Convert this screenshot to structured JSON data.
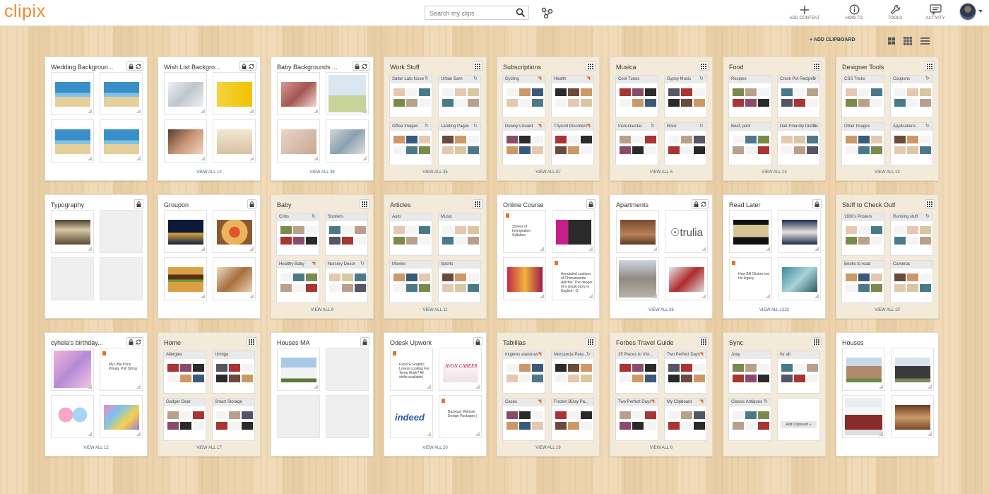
{
  "app": {
    "logo": "clipix",
    "search_placeholder": "Search my clips",
    "nav": [
      {
        "label": "ADD CONTENT",
        "icon": "plus-icon"
      },
      {
        "label": "HOW TO",
        "icon": "info-icon"
      },
      {
        "label": "TOOLS",
        "icon": "wrench-icon"
      },
      {
        "label": "ACTIVITY",
        "icon": "chat-icon"
      }
    ],
    "add_clipboard": "+ ADD CLIPBOARD"
  },
  "colors": {
    "accent": "#f28a2a",
    "link": "#3f5f86"
  },
  "cards": [
    {
      "title": "Wedding Backgroun...",
      "icons": [
        "lock",
        "sync"
      ],
      "cells": [
        "beach-chairs",
        "beach-chairs",
        "beach-chairs",
        "beach-chairs"
      ],
      "footer": ""
    },
    {
      "title": "Wish List Backgro...",
      "icons": [
        "lock",
        "sync"
      ],
      "cells": [
        "silver-gifts",
        "yellow-gift",
        "couple",
        "beach-list"
      ],
      "footer": "VIEW ALL 12"
    },
    {
      "title": "Baby Backgrounds ...",
      "icons": [
        "lock",
        "sync"
      ],
      "cells": [
        "family",
        "pregnant",
        "baby",
        "baby-bath"
      ],
      "footer": "VIEW ALL 39"
    },
    {
      "title": "Work Stuff",
      "icons": [
        "grid"
      ],
      "boards": [
        {
          "name": "Safari Lato Issue",
          "icon": "sync"
        },
        {
          "name": "Urban Barn",
          "icon": "sync"
        },
        {
          "name": "Office Images",
          "icon": "sync"
        },
        {
          "name": "Landing Pages",
          "icon": "sync"
        }
      ],
      "footer": "VIEW ALL 35"
    },
    {
      "title": "Subscriptions",
      "icons": [
        "grid"
      ],
      "boards": [
        {
          "name": "Cycling",
          "icon": "rss"
        },
        {
          "name": "Health",
          "icon": "rss"
        },
        {
          "name": "Dewey's board",
          "icon": "rss"
        },
        {
          "name": "Thyroid Disorders",
          "icon": "rss"
        }
      ],
      "footer": "VIEW ALL 57"
    },
    {
      "title": "Musica",
      "icons": [
        "grid"
      ],
      "boards": [
        {
          "name": "Cool Tunes",
          "icon": ""
        },
        {
          "name": "Gypsy Music",
          "icon": "sync"
        },
        {
          "name": "Instrumental",
          "icon": "sync"
        },
        {
          "name": "Rock",
          "icon": "sync"
        }
      ],
      "footer": "VIEW ALL 5"
    },
    {
      "title": "Food",
      "icons": [
        "grid"
      ],
      "boards": [
        {
          "name": "Recipes",
          "icon": ""
        },
        {
          "name": "Crock Pot Recipes",
          "icon": "sync"
        },
        {
          "name": "Beef, pork",
          "icon": ""
        },
        {
          "name": "Diet-Friendly Dishes",
          "icon": "sync"
        }
      ],
      "footer": "VIEW ALL 13"
    },
    {
      "title": "Designer Tools",
      "icons": [
        "grid"
      ],
      "boards": [
        {
          "name": "CSS Tricks",
          "icon": ""
        },
        {
          "name": "Coupons",
          "icon": "sync"
        },
        {
          "name": "Other Images",
          "icon": ""
        },
        {
          "name": "Applications",
          "icon": "sync"
        }
      ],
      "footer": "VIEW ALL 13"
    },
    {
      "title": "Typography",
      "icons": [
        "lock"
      ],
      "cells": [
        "paradise",
        "",
        "",
        ""
      ],
      "footer": ""
    },
    {
      "title": "Groupon",
      "icons": [
        "lock"
      ],
      "cells": [
        "city-night",
        "pizza",
        "burger",
        "wraps"
      ],
      "footer": ""
    },
    {
      "title": "Baby",
      "icons": [
        "grid"
      ],
      "boards": [
        {
          "name": "Cribs",
          "icon": "sync"
        },
        {
          "name": "Strollers",
          "icon": ""
        },
        {
          "name": "Healthy Baby",
          "icon": "rss"
        },
        {
          "name": "Nursery Decor",
          "icon": "sync"
        }
      ],
      "footer": "VIEW ALL 9"
    },
    {
      "title": "Articles",
      "icons": [
        "grid"
      ],
      "boards": [
        {
          "name": "Auto",
          "icon": ""
        },
        {
          "name": "Music",
          "icon": ""
        },
        {
          "name": "Movies",
          "icon": ""
        },
        {
          "name": "Sports",
          "icon": ""
        }
      ],
      "footer": "VIEW ALL 11"
    },
    {
      "title": "Online Course",
      "icons": [
        "lock"
      ],
      "cells": [
        "note:Stories of Immigration Syllabus",
        "video",
        "speaker",
        "note:Annotated captions of Chimamanda Adichie: The danger of a single story in English | O"
      ],
      "footer": ""
    },
    {
      "title": "Apartments",
      "icons": [
        "lock",
        "sync"
      ],
      "cells": [
        "kitchen-wood",
        "trulia",
        "building",
        "kitchen-red"
      ],
      "footer": "VIEW ALL 26"
    },
    {
      "title": "Read Later",
      "icons": [
        "lock"
      ],
      "cells": [
        "world-map",
        "old-man",
        "note:How Bill Clinton lost his legacy",
        "illustration"
      ],
      "footer": "VIEW ALL 1232"
    },
    {
      "title": "Stuff to Check Out!",
      "icons": [
        "grid"
      ],
      "boards": [
        {
          "name": "1930's Posters",
          "icon": ""
        },
        {
          "name": "Running stuff",
          "icon": "sync"
        },
        {
          "name": "Books to read",
          "icon": ""
        },
        {
          "name": "Cameras",
          "icon": ""
        }
      ],
      "footer": "VIEW ALL 10"
    },
    {
      "title": "cyhela's birthday...",
      "icons": [
        "lock",
        "sync"
      ],
      "cells": [
        "pony",
        "note:My Little Pony Pinata, Pull String",
        "balloons",
        "ponies"
      ],
      "footer": "VIEW ALL 12"
    },
    {
      "title": "Home",
      "icons": [
        "grid"
      ],
      "boards": [
        {
          "name": "Allergies",
          "icon": ""
        },
        {
          "name": "Urmiga",
          "icon": ""
        },
        {
          "name": "Gadget Gear",
          "icon": ""
        },
        {
          "name": "Smart Storage",
          "icon": ""
        }
      ],
      "footer": "VIEW ALL 17"
    },
    {
      "title": "Houses MA",
      "icons": [
        "lock"
      ],
      "cells": [
        "house-white",
        "",
        "",
        ""
      ],
      "footer": ""
    },
    {
      "title": "Odesk Upwork",
      "icons": [
        "lock"
      ],
      "cells": [
        "note:Excel & Graphic Lovers Looking For Temp Work? All shifts available!",
        "avon",
        "indeed",
        "note:Bazinga! Website Design Packages |"
      ],
      "footer": "VIEW ALL 20"
    },
    {
      "title": "Tablillas",
      "icons": [
        "grid"
      ],
      "boards": [
        {
          "name": "mujeres asesinas",
          "icon": "rss"
        },
        {
          "name": "Mercancia Para...",
          "icon": "sync"
        },
        {
          "name": "Cases",
          "icon": "rss"
        },
        {
          "name": "Frozen BDay Pa...",
          "icon": ""
        }
      ],
      "footer": "VIEW ALL 19"
    },
    {
      "title": "Forbes Travel Guide",
      "icons": [
        "grid"
      ],
      "boards": [
        {
          "name": "25 Places to Visi...",
          "icon": ""
        },
        {
          "name": "Two Perfect Days",
          "icon": "rss"
        },
        {
          "name": "Two Perfect Days",
          "icon": "rss"
        },
        {
          "name": "My Clipboard",
          "icon": "rss"
        }
      ],
      "footer": "VIEW ALL 6"
    },
    {
      "title": "Sync",
      "icons": [
        "grid"
      ],
      "boards": [
        {
          "name": "Joey",
          "icon": ""
        },
        {
          "name": "for all",
          "icon": ""
        },
        {
          "name": "Classic Antiques",
          "icon": "sync"
        },
        {
          "name": "",
          "icon": "",
          "add": "Add Clipboard +"
        }
      ],
      "footer": ""
    },
    {
      "title": "Houses",
      "icons": [],
      "cells": [
        "house-a",
        "house-b",
        "house-c",
        "interior"
      ],
      "footer": ""
    }
  ]
}
